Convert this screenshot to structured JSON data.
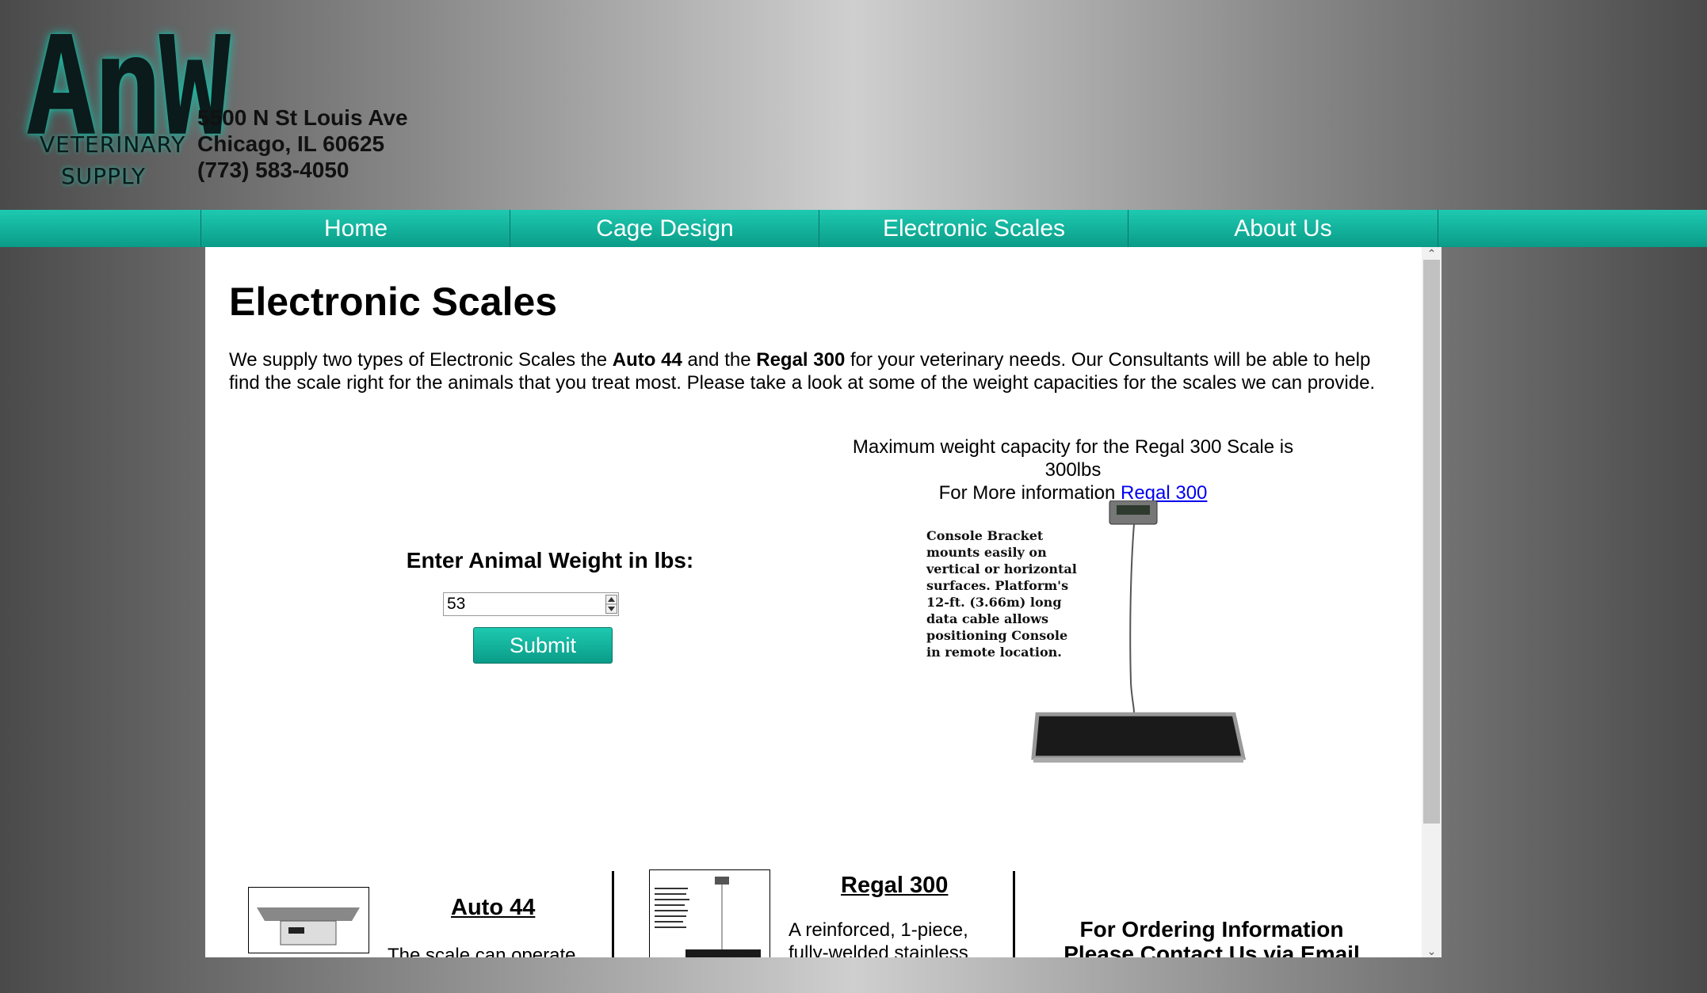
{
  "logo": {
    "big": "AnW",
    "line1": "VETERINARY",
    "line2": "SUPPLY"
  },
  "address": {
    "street": "5500 N St Louis Ave",
    "city": "Chicago, IL 60625",
    "phone": "(773) 583-4050"
  },
  "nav": [
    "Home",
    "Cage Design",
    "Electronic Scales",
    "About Us"
  ],
  "page": {
    "title": "Electronic Scales",
    "intro_pre": "We supply two types of Electronic Scales the ",
    "intro_b1": "Auto 44",
    "intro_mid": " and the ",
    "intro_b2": "Regal 300",
    "intro_post": " for your veterinary needs. Our Consultants will be able to help find the scale right for the animals that you treat most. Please take a look at some of the weight capacities for the scales we can provide."
  },
  "calculator": {
    "label": "Enter Animal Weight in lbs:",
    "value": "53",
    "submit": "Submit"
  },
  "result": {
    "line1": "Maximum weight capacity for the Regal 300 Scale is 300lbs",
    "line2_pre": "For More information ",
    "link": "Regal 300"
  },
  "scale_caption": "Console Bracket mounts easily on vertical or horizontal surfaces. Platform's 12-ft. (3.66m) long data cable allows positioning Console in remote location.",
  "products": [
    {
      "title": "Auto 44",
      "desc": "The scale can operate"
    },
    {
      "title": "Regal 300",
      "desc1": "A reinforced, 1-piece,",
      "desc2": "fully-welded stainless"
    }
  ],
  "order": {
    "line1": "For Ordering Information",
    "line2": "Please Contact Us via Email"
  }
}
